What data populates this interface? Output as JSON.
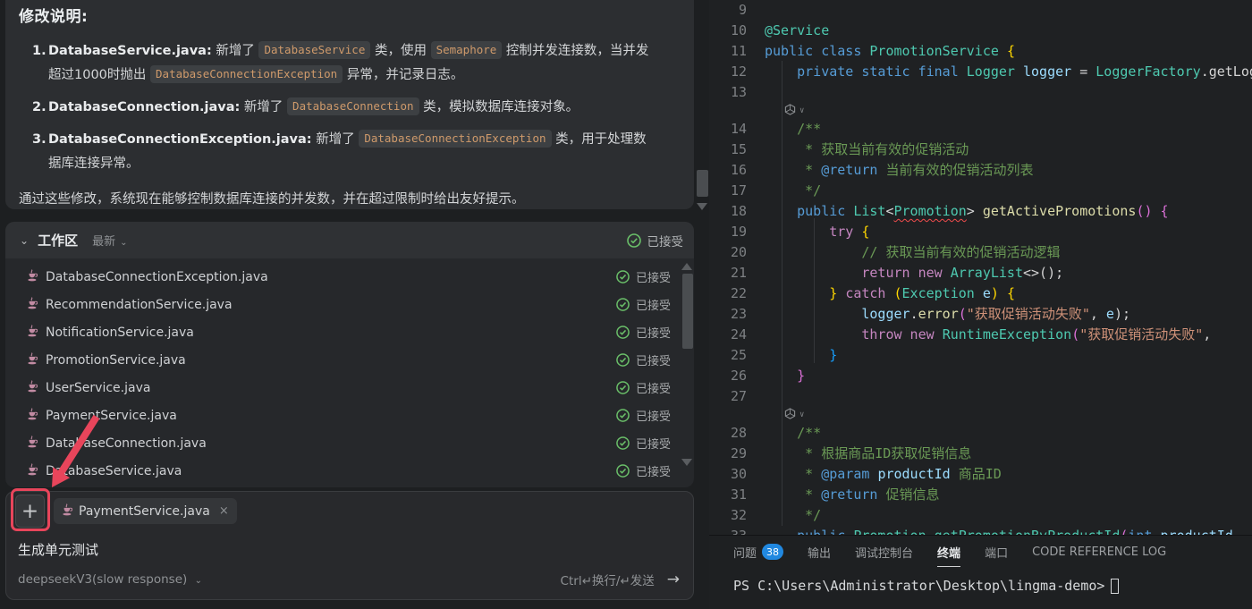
{
  "chat": {
    "title": "修改说明:",
    "items": [
      {
        "marker": "1.",
        "name": "DatabaseService.java:",
        "segments": [
          {
            "t": " 新增了 "
          },
          {
            "t": "DatabaseService",
            "code": true
          },
          {
            "t": " 类，使用 "
          },
          {
            "t": "Semaphore",
            "code": true
          },
          {
            "t": " 控制并发连接数，当并发超过1000时抛出 "
          },
          {
            "t": "DatabaseConnectionException",
            "code": true
          },
          {
            "t": " 异常，并记录日志。"
          }
        ]
      },
      {
        "marker": "2.",
        "name": "DatabaseConnection.java:",
        "segments": [
          {
            "t": " 新增了 "
          },
          {
            "t": "DatabaseConnection",
            "code": true
          },
          {
            "t": " 类，模拟数据库连接对象。"
          }
        ]
      },
      {
        "marker": "3.",
        "name": "DatabaseConnectionException.java:",
        "segments": [
          {
            "t": " 新增了 "
          },
          {
            "t": "DatabaseConnectionException",
            "code": true
          },
          {
            "t": " 类，用于处理数据库连接异常。"
          }
        ]
      }
    ],
    "summary": "通过这些修改，系统现在能够控制数据库连接的并发数，并在超过限制时给出友好提示。"
  },
  "workspace": {
    "title": "工作区",
    "filter": "最新",
    "accepted_label": "已接受",
    "files": [
      {
        "name": "DatabaseConnectionException.java",
        "status": "已接受"
      },
      {
        "name": "RecommendationService.java",
        "status": "已接受"
      },
      {
        "name": "NotificationService.java",
        "status": "已接受"
      },
      {
        "name": "PromotionService.java",
        "status": "已接受"
      },
      {
        "name": "UserService.java",
        "status": "已接受"
      },
      {
        "name": "PaymentService.java",
        "status": "已接受"
      },
      {
        "name": "DatabaseConnection.java",
        "status": "已接受"
      },
      {
        "name": "DatabaseService.java",
        "status": "已接受"
      }
    ]
  },
  "composer": {
    "plus_label": "+",
    "attachment": "PaymentService.java",
    "close_label": "×",
    "message": "生成单元测试",
    "model": "deepseekV3(slow response)",
    "shortcut": "Ctrl↵换行/↵发送",
    "send_label": "→"
  },
  "editor": {
    "lines": [
      {
        "n": "9",
        "seg": []
      },
      {
        "n": "10",
        "seg": [
          {
            "t": "@Service",
            "c": "type"
          }
        ]
      },
      {
        "n": "11",
        "seg": [
          {
            "t": "public class ",
            "c": "kw"
          },
          {
            "t": "PromotionService ",
            "c": "type"
          },
          {
            "t": "{",
            "c": "b1"
          }
        ]
      },
      {
        "n": "12",
        "seg": [
          {
            "t": "    ",
            "c": "pl"
          },
          {
            "t": "private static final ",
            "c": "kw"
          },
          {
            "t": "Logger ",
            "c": "type"
          },
          {
            "t": "logger ",
            "c": "var"
          },
          {
            "t": "= ",
            "c": "pl"
          },
          {
            "t": "LoggerFactory",
            "c": "type"
          },
          {
            "t": ".getLogger",
            "c": "pl"
          }
        ]
      },
      {
        "n": "13",
        "seg": []
      },
      {
        "widget": true
      },
      {
        "n": "14",
        "seg": [
          {
            "t": "    ",
            "c": "pl"
          },
          {
            "t": "/**",
            "c": "cmt"
          }
        ]
      },
      {
        "n": "15",
        "seg": [
          {
            "t": "     ",
            "c": "pl"
          },
          {
            "t": "* 获取当前有效的促销活动",
            "c": "cmt"
          }
        ]
      },
      {
        "n": "16",
        "seg": [
          {
            "t": "     ",
            "c": "pl"
          },
          {
            "t": "* ",
            "c": "cmt"
          },
          {
            "t": "@return ",
            "c": "kw"
          },
          {
            "t": "当前有效的促销活动列表",
            "c": "cmt"
          }
        ]
      },
      {
        "n": "17",
        "seg": [
          {
            "t": "     ",
            "c": "pl"
          },
          {
            "t": "*/",
            "c": "cmt"
          }
        ]
      },
      {
        "n": "18",
        "seg": [
          {
            "t": "    ",
            "c": "pl"
          },
          {
            "t": "public ",
            "c": "kw"
          },
          {
            "t": "List",
            "c": "type"
          },
          {
            "t": "<",
            "c": "pl"
          },
          {
            "t": "Promotion",
            "c": "type",
            "err": true
          },
          {
            "t": "> ",
            "c": "pl"
          },
          {
            "t": "getActivePromotions",
            "c": "fn"
          },
          {
            "t": "() ",
            "c": "b2"
          },
          {
            "t": "{",
            "c": "b2"
          }
        ]
      },
      {
        "n": "19",
        "seg": [
          {
            "t": "        ",
            "c": "pl"
          },
          {
            "t": "try ",
            "c": "kw2"
          },
          {
            "t": "{",
            "c": "b1"
          }
        ]
      },
      {
        "n": "20",
        "seg": [
          {
            "t": "            ",
            "c": "pl"
          },
          {
            "t": "// 获取当前有效的促销活动逻辑",
            "c": "cmt"
          }
        ]
      },
      {
        "n": "21",
        "seg": [
          {
            "t": "            ",
            "c": "pl"
          },
          {
            "t": "return new ",
            "c": "kw2"
          },
          {
            "t": "ArrayList",
            "c": "type"
          },
          {
            "t": "<>();",
            "c": "pl"
          }
        ]
      },
      {
        "n": "22",
        "seg": [
          {
            "t": "        ",
            "c": "pl"
          },
          {
            "t": "} ",
            "c": "b1"
          },
          {
            "t": "catch ",
            "c": "kw2"
          },
          {
            "t": "(",
            "c": "b1"
          },
          {
            "t": "Exception ",
            "c": "type"
          },
          {
            "t": "e",
            "c": "var"
          },
          {
            "t": ") ",
            "c": "b1"
          },
          {
            "t": "{",
            "c": "b1"
          }
        ]
      },
      {
        "n": "23",
        "seg": [
          {
            "t": "            ",
            "c": "pl"
          },
          {
            "t": "logger",
            "c": "var"
          },
          {
            "t": ".",
            "c": "pl"
          },
          {
            "t": "error",
            "c": "fn"
          },
          {
            "t": "(",
            "c": "b2"
          },
          {
            "t": "\"获取促销活动失败\"",
            "c": "str"
          },
          {
            "t": ", ",
            "c": "pl"
          },
          {
            "t": "e",
            "c": "var"
          },
          {
            "t": ");",
            "c": "pl"
          }
        ]
      },
      {
        "n": "24",
        "seg": [
          {
            "t": "            ",
            "c": "pl"
          },
          {
            "t": "throw new ",
            "c": "kw2"
          },
          {
            "t": "RuntimeException",
            "c": "type"
          },
          {
            "t": "(",
            "c": "b2"
          },
          {
            "t": "\"获取促销活动失败\"",
            "c": "str"
          },
          {
            "t": ",",
            "c": "pl"
          }
        ]
      },
      {
        "n": "25",
        "seg": [
          {
            "t": "        ",
            "c": "pl"
          },
          {
            "t": "}",
            "c": "b3"
          }
        ]
      },
      {
        "n": "26",
        "seg": [
          {
            "t": "    ",
            "c": "pl"
          },
          {
            "t": "}",
            "c": "b2"
          }
        ]
      },
      {
        "n": "27",
        "seg": []
      },
      {
        "widget": true
      },
      {
        "n": "28",
        "seg": [
          {
            "t": "    ",
            "c": "pl"
          },
          {
            "t": "/**",
            "c": "cmt"
          }
        ]
      },
      {
        "n": "29",
        "seg": [
          {
            "t": "     ",
            "c": "pl"
          },
          {
            "t": "* 根据商品ID获取促销信息",
            "c": "cmt"
          }
        ]
      },
      {
        "n": "30",
        "seg": [
          {
            "t": "     ",
            "c": "pl"
          },
          {
            "t": "* ",
            "c": "cmt"
          },
          {
            "t": "@param ",
            "c": "kw"
          },
          {
            "t": "productId ",
            "c": "var"
          },
          {
            "t": "商品ID",
            "c": "cmt"
          }
        ]
      },
      {
        "n": "31",
        "seg": [
          {
            "t": "     ",
            "c": "pl"
          },
          {
            "t": "* ",
            "c": "cmt"
          },
          {
            "t": "@return ",
            "c": "kw"
          },
          {
            "t": "促销信息",
            "c": "cmt"
          }
        ]
      },
      {
        "n": "32",
        "seg": [
          {
            "t": "     ",
            "c": "pl"
          },
          {
            "t": "*/",
            "c": "cmt"
          }
        ]
      },
      {
        "n": "33",
        "seg": [
          {
            "t": "    ",
            "c": "pl"
          },
          {
            "t": "public ",
            "c": "kw"
          },
          {
            "t": "Promotion ",
            "c": "type",
            "err": true
          },
          {
            "t": "getPromotionByProductId",
            "c": "type"
          },
          {
            "t": "(",
            "c": "b2"
          },
          {
            "t": "int ",
            "c": "kw"
          },
          {
            "t": "productId",
            "c": "var"
          }
        ]
      }
    ]
  },
  "bottom_panel": {
    "tabs": [
      {
        "label": "问题",
        "badge": "38"
      },
      {
        "label": "输出"
      },
      {
        "label": "调试控制台"
      },
      {
        "label": "终端",
        "active": true
      },
      {
        "label": "端口"
      },
      {
        "label": "CODE REFERENCE LOG"
      }
    ],
    "terminal_prompt": "PS C:\\Users\\Administrator\\Desktop\\lingma-demo>"
  },
  "colors": {
    "annotation": "#e8455b",
    "accent_green": "#6abf69",
    "badge_blue": "#2188e0"
  }
}
